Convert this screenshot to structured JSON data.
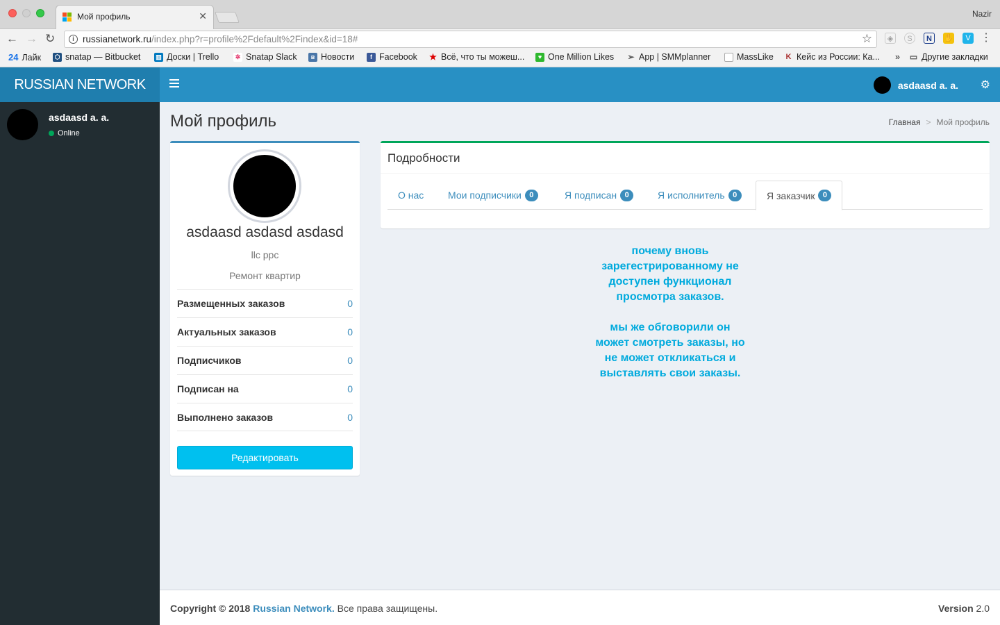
{
  "browser": {
    "tab_title": "Мой профиль",
    "profile_name": "Nazir",
    "url_host": "russianetwork.ru",
    "url_rest": "/index.php?r=profile%2Fdefault%2Findex&id=18#",
    "bookmarks": [
      {
        "label": "Лайк",
        "icon": "24"
      },
      {
        "label": "snatap — Bitbucket"
      },
      {
        "label": "Доски | Trello"
      },
      {
        "label": "Snatap Slack"
      },
      {
        "label": "Новости"
      },
      {
        "label": "Facebook"
      },
      {
        "label": "Всё, что ты можеш..."
      },
      {
        "label": "One Million Likes"
      },
      {
        "label": "App | SMMplanner"
      },
      {
        "label": "MassLike"
      },
      {
        "label": "Кейс из России: Ка..."
      },
      {
        "label": "»"
      },
      {
        "label": "Другие закладки"
      }
    ]
  },
  "header": {
    "logo": "RUSSIAN NETWORK",
    "user_name": "asdaasd a. a."
  },
  "sidebar": {
    "user_name": "asdaasd a. a.",
    "status": "Online"
  },
  "page": {
    "title": "Мой профиль",
    "breadcrumb": [
      "Главная",
      ">",
      "Мой профиль"
    ]
  },
  "profile": {
    "full_name": "asdaasd asdasd asdasd",
    "company": "llc ppc",
    "specialty": "Ремонт квартир",
    "stats": [
      {
        "label": "Размещенных заказов",
        "value": "0"
      },
      {
        "label": "Актуальных заказов",
        "value": "0"
      },
      {
        "label": "Подписчиков",
        "value": "0"
      },
      {
        "label": "Подписан на",
        "value": "0"
      },
      {
        "label": "Выполнено заказов",
        "value": "0"
      }
    ],
    "edit_label": "Редактировать"
  },
  "details": {
    "title": "Подробности",
    "tabs": [
      {
        "label": "О нас"
      },
      {
        "label": "Мои подписчики",
        "badge": "0"
      },
      {
        "label": "Я подписан",
        "badge": "0"
      },
      {
        "label": "Я исполнитель",
        "badge": "0"
      },
      {
        "label": "Я заказчик",
        "badge": "0",
        "active": true
      }
    ]
  },
  "note": {
    "line1": "почему вновь",
    "line2": "зарегестрированному не",
    "line3": "доступен функционал",
    "line4": "просмотра заказов.",
    "line5": "мы же обговорили он",
    "line6": "может смотреть заказы, но",
    "line7": "не может откликаться и",
    "line8": "выставлять свои заказы."
  },
  "footer": {
    "copyright": "Copyright © 2018",
    "company": "Russian Network.",
    "rights": "Все права защищены.",
    "version_label": "Version",
    "version": "2.0"
  },
  "colors": {
    "header": "#2890c4",
    "sidebar": "#222d32",
    "accent": "#3c8dbc",
    "note": "#00aadd"
  }
}
